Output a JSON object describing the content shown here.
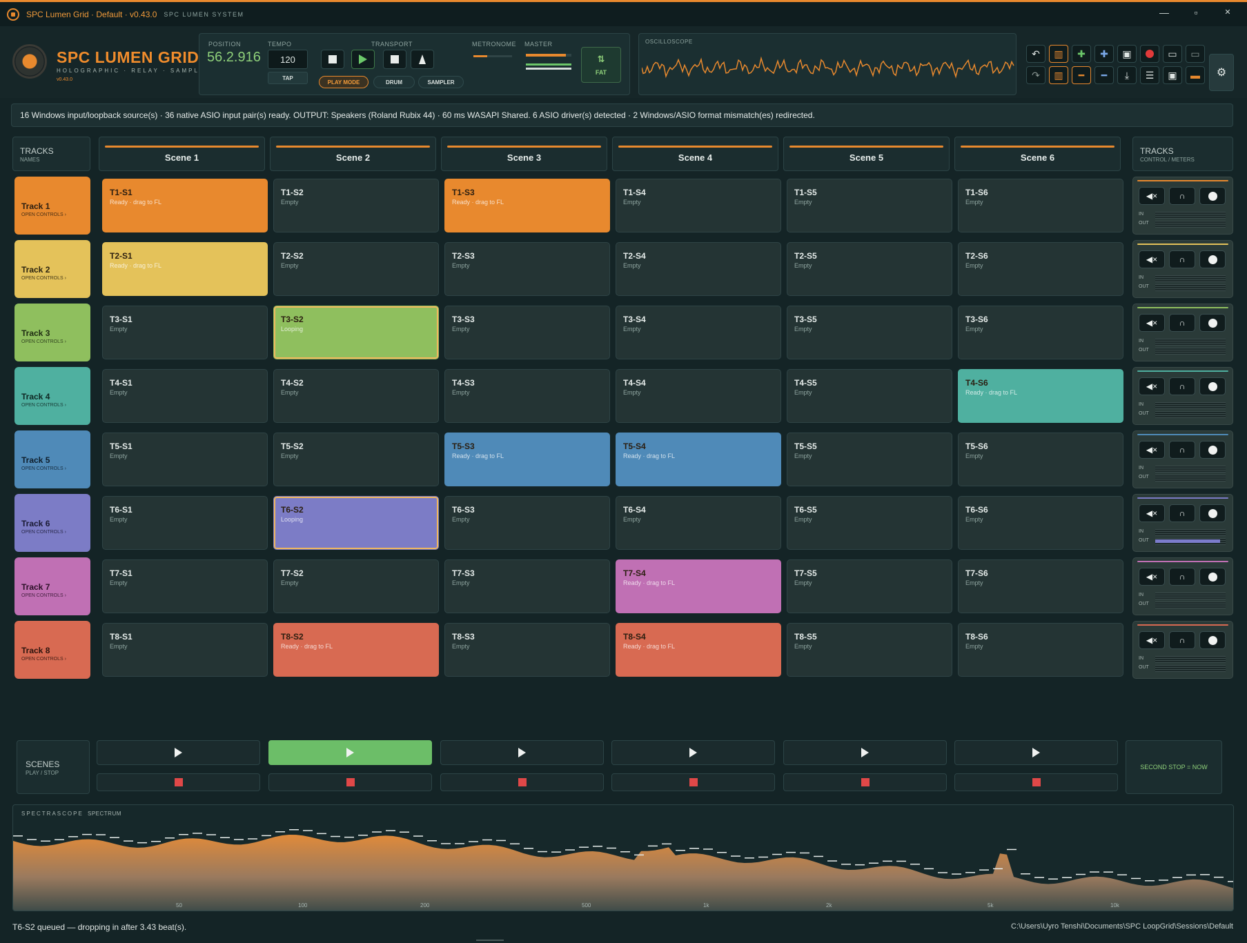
{
  "window": {
    "title": "SPC Lumen Grid · Default · v0.43.0",
    "subtitle": "SPC LUMEN SYSTEM",
    "minimize": "—",
    "maximize": "▫",
    "close": "✕"
  },
  "brand": {
    "name": "SPC LUMEN GRID",
    "tagline": "HOLOGRAPHIC · RELAY · SAMPLER",
    "version": "v0.43.0"
  },
  "transport": {
    "position_label": "POSITION",
    "position": "56.2.916",
    "tempo_label": "TEMPO",
    "tempo": "120",
    "tap": "TAP",
    "transport_label": "TRANSPORT",
    "metronome_label": "METRONOME",
    "master_label": "MASTER",
    "modes": [
      "PLAY MODE",
      "DRUM",
      "SAMPLER"
    ],
    "fat": "FAT"
  },
  "oscilloscope": {
    "label": "OSCILLOSCOPE"
  },
  "toolbar_icons": [
    "undo-icon",
    "bars-icon",
    "add-green-icon",
    "add-blue-icon",
    "save-icon",
    "record-icon",
    "monitor-icon",
    "monitor-dim-icon",
    "redo-icon",
    "bars-icon",
    "remove-icon",
    "remove-icon",
    "download-icon",
    "mixer-icon",
    "save-icon",
    "orange-monitor-icon"
  ],
  "status": "16 Windows input/loopback source(s) · 36 native ASIO input pair(s) ready. OUTPUT: Speakers (Roland Rubix 44) · 60 ms WASAPI Shared. 6 ASIO driver(s) detected · 2 Windows/ASIO format mismatch(es) redirected.",
  "tracks_header": {
    "title": "TRACKS",
    "sub": "NAMES"
  },
  "controls_header": {
    "title": "TRACKS",
    "sub": "CONTROL / METERS"
  },
  "scenes": [
    "Scene 1",
    "Scene 2",
    "Scene 3",
    "Scene 4",
    "Scene 5",
    "Scene 6"
  ],
  "open_controls": "OPEN CONTROLS ›",
  "tracks": [
    {
      "name": "Track 1",
      "color": "#e8892e",
      "text": "#2b1e10",
      "out": 0
    },
    {
      "name": "Track 2",
      "color": "#e4c25a",
      "text": "#2b2410",
      "out": 0
    },
    {
      "name": "Track 3",
      "color": "#8fbf5e",
      "text": "#1e2c12",
      "out": 0
    },
    {
      "name": "Track 4",
      "color": "#4fb0a0",
      "text": "#0f2824",
      "out": 0
    },
    {
      "name": "Track 5",
      "color": "#4f8ab8",
      "text": "#0f1e2c",
      "out": 0
    },
    {
      "name": "Track 6",
      "color": "#7c7cc6",
      "text": "#1a1a34",
      "out": 0.92
    },
    {
      "name": "Track 7",
      "color": "#c070b4",
      "text": "#2c1028",
      "out": 0
    },
    {
      "name": "Track 8",
      "color": "#d86a52",
      "text": "#2c140e",
      "out": 0
    }
  ],
  "clips": [
    [
      {
        "name": "T1-S1",
        "state": "Ready · drag to FL",
        "filled": true
      },
      {
        "name": "T1-S2",
        "state": "Empty"
      },
      {
        "name": "T1-S3",
        "state": "Ready · drag to FL",
        "filled": true
      },
      {
        "name": "T1-S4",
        "state": "Empty"
      },
      {
        "name": "T1-S5",
        "state": "Empty"
      },
      {
        "name": "T1-S6",
        "state": "Empty"
      }
    ],
    [
      {
        "name": "T2-S1",
        "state": "Ready · drag to FL",
        "filled": true
      },
      {
        "name": "T2-S2",
        "state": "Empty"
      },
      {
        "name": "T2-S3",
        "state": "Empty"
      },
      {
        "name": "T2-S4",
        "state": "Empty"
      },
      {
        "name": "T2-S5",
        "state": "Empty"
      },
      {
        "name": "T2-S6",
        "state": "Empty"
      }
    ],
    [
      {
        "name": "T3-S1",
        "state": "Empty"
      },
      {
        "name": "T3-S2",
        "state": "Looping",
        "filled": true,
        "looping": true
      },
      {
        "name": "T3-S3",
        "state": "Empty"
      },
      {
        "name": "T3-S4",
        "state": "Empty"
      },
      {
        "name": "T3-S5",
        "state": "Empty"
      },
      {
        "name": "T3-S6",
        "state": "Empty"
      }
    ],
    [
      {
        "name": "T4-S1",
        "state": "Empty"
      },
      {
        "name": "T4-S2",
        "state": "Empty"
      },
      {
        "name": "T4-S3",
        "state": "Empty"
      },
      {
        "name": "T4-S4",
        "state": "Empty"
      },
      {
        "name": "T4-S5",
        "state": "Empty"
      },
      {
        "name": "T4-S6",
        "state": "Ready · drag to FL",
        "filled": true
      }
    ],
    [
      {
        "name": "T5-S1",
        "state": "Empty"
      },
      {
        "name": "T5-S2",
        "state": "Empty"
      },
      {
        "name": "T5-S3",
        "state": "Ready · drag to FL",
        "filled": true
      },
      {
        "name": "T5-S4",
        "state": "Ready · drag to FL",
        "filled": true
      },
      {
        "name": "T5-S5",
        "state": "Empty"
      },
      {
        "name": "T5-S6",
        "state": "Empty"
      }
    ],
    [
      {
        "name": "T6-S1",
        "state": "Empty"
      },
      {
        "name": "T6-S2",
        "state": "Looping",
        "filled": true,
        "looping": true
      },
      {
        "name": "T6-S3",
        "state": "Empty"
      },
      {
        "name": "T6-S4",
        "state": "Empty"
      },
      {
        "name": "T6-S5",
        "state": "Empty"
      },
      {
        "name": "T6-S6",
        "state": "Empty"
      }
    ],
    [
      {
        "name": "T7-S1",
        "state": "Empty"
      },
      {
        "name": "T7-S2",
        "state": "Empty"
      },
      {
        "name": "T7-S3",
        "state": "Empty"
      },
      {
        "name": "T7-S4",
        "state": "Ready · drag to FL",
        "filled": true
      },
      {
        "name": "T7-S5",
        "state": "Empty"
      },
      {
        "name": "T7-S6",
        "state": "Empty"
      }
    ],
    [
      {
        "name": "T8-S1",
        "state": "Empty"
      },
      {
        "name": "T8-S2",
        "state": "Ready · drag to FL",
        "filled": true
      },
      {
        "name": "T8-S3",
        "state": "Empty"
      },
      {
        "name": "T8-S4",
        "state": "Ready · drag to FL",
        "filled": true
      },
      {
        "name": "T8-S5",
        "state": "Empty"
      },
      {
        "name": "T8-S6",
        "state": "Empty"
      }
    ]
  ],
  "meter_labels": {
    "in": "IN",
    "out": "OUT"
  },
  "scene_controls": {
    "title": "SCENES",
    "sub": "PLAY / STOP",
    "active_scene": 2,
    "second_stop": "SECOND STOP = NOW"
  },
  "spectrum": {
    "label": "SPECTRASCOPE",
    "sub": "SPECTRUM",
    "ticks": [
      "50",
      "100",
      "200",
      "500",
      "1k",
      "2k",
      "5k",
      "10k"
    ]
  },
  "footer": {
    "message": "T6-S2 queued — dropping in after 3.43 beat(s).",
    "path": "C:\\Users\\Uyro Tenshi\\Documents\\SPC LoopGrid\\Sessions\\Default"
  },
  "colors": {
    "accent": "#e8892e",
    "green": "#6cc86a",
    "bg": "#142426"
  }
}
